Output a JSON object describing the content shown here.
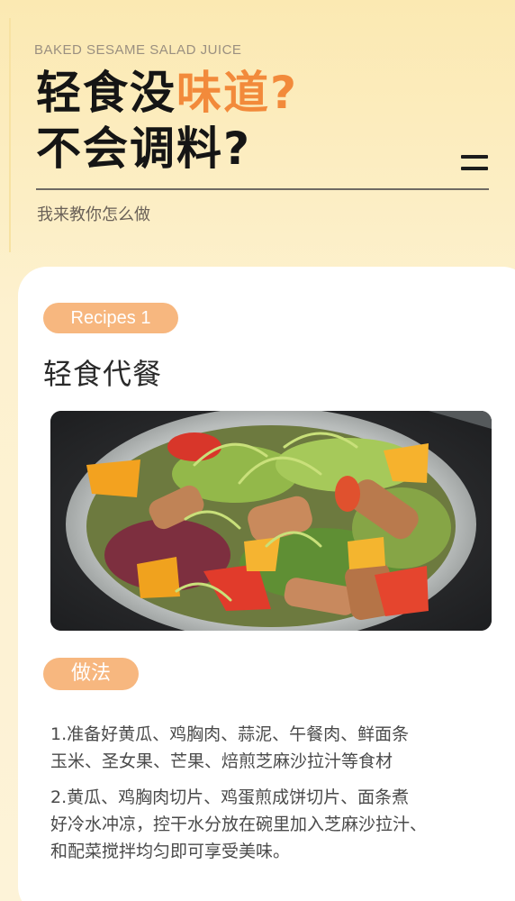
{
  "header": {
    "subtitle_en": "BAKED SESAME SALAD JUICE",
    "headline_line1_plain": "轻食没",
    "headline_line1_accent": "味道",
    "headline_line1_end": "?",
    "headline_line2": "不会调料?",
    "tagline": "我来教你怎么做",
    "menu_icon": "menu-icon"
  },
  "recipe": {
    "badge": "Recipes 1",
    "title": "轻食代餐",
    "photo_icon": "salad-photo",
    "method_badge": "做法",
    "steps": [
      {
        "lines": [
          "1.准备好黄瓜、鸡胸肉、蒜泥、午餐肉、鲜面条",
          "玉米、圣女果、芒果、焙煎芝麻沙拉汁等食材"
        ]
      },
      {
        "lines": [
          "2.黄瓜、鸡胸肉切片、鸡蛋煎成饼切片、面条煮",
          "好冷水冲凉，控干水分放在碗里加入芝麻沙拉汁、",
          "和配菜搅拌均匀即可享受美味。"
        ]
      }
    ]
  },
  "colors": {
    "accent": "#f28a3b",
    "pill": "#f7b77f",
    "background_top": "#fbe9b2",
    "card": "#ffffff",
    "text_dark": "#151515"
  }
}
